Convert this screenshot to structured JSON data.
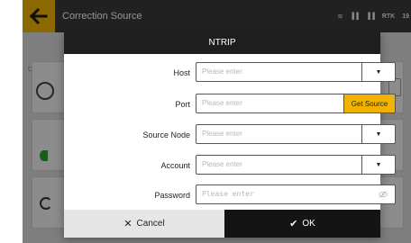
{
  "app_bar": {
    "title": "Correction Source",
    "status": {
      "signal1": "▐▐",
      "signal2": "▐▐",
      "rtk": "RTK",
      "time": "19"
    }
  },
  "background": {
    "label": "Corre"
  },
  "dialog": {
    "title": "NTRIP",
    "fields": [
      {
        "label": "Host",
        "placeholder": "Please enter",
        "control": "dropdown"
      },
      {
        "label": "Port",
        "placeholder": "Please enter",
        "control": "button",
        "button_label": "Get Source"
      },
      {
        "label": "Source Node",
        "placeholder": "Please enter",
        "control": "dropdown"
      },
      {
        "label": "Account",
        "placeholder": "Please enter",
        "control": "dropdown"
      },
      {
        "label": "Password",
        "placeholder": "Please enter",
        "control": "visibility-toggle"
      }
    ],
    "cancel_label": "Cancel",
    "ok_label": "OK"
  },
  "icons": {
    "back": "arrow-left-icon",
    "dropdown": "caret-down-icon",
    "visibility": "eye-off-icon",
    "cancel": "close-icon",
    "ok": "check-icon"
  },
  "colors": {
    "accent": "#f2b300",
    "header_bg": "#1e1e1e",
    "ok_bg": "#141414",
    "cancel_bg": "#e6e6e6"
  }
}
